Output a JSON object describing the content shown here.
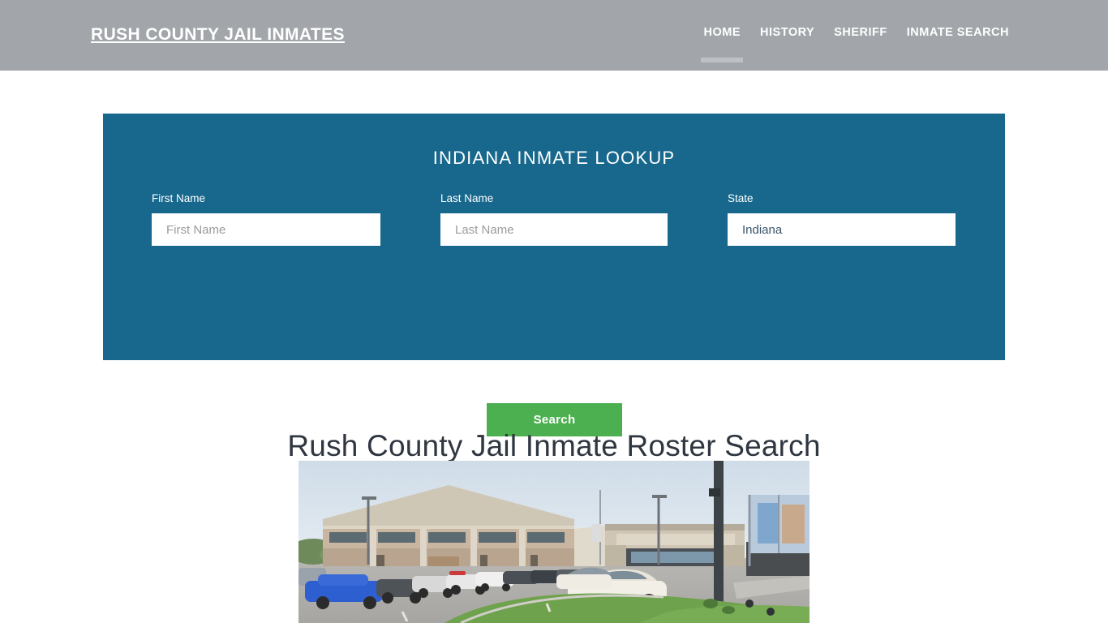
{
  "header": {
    "brand": "Rush County Jail Inmates",
    "nav": [
      {
        "label": "Home",
        "active": true
      },
      {
        "label": "History",
        "active": false
      },
      {
        "label": "Sheriff",
        "active": false
      },
      {
        "label": "Inmate Search",
        "active": false
      }
    ]
  },
  "lookup": {
    "title": "Indiana Inmate Lookup",
    "accent_color": "#17688c",
    "button_color": "#4cb050",
    "fields": {
      "first_name": {
        "label": "First Name",
        "placeholder": "First Name",
        "value": ""
      },
      "last_name": {
        "label": "Last Name",
        "placeholder": "Last Name",
        "value": ""
      },
      "state": {
        "label": "State",
        "value": "Indiana",
        "options": [
          "Indiana"
        ]
      }
    },
    "search_button": "Search"
  },
  "main": {
    "heading": "Rush County Jail Inmate Roster Search",
    "photo_alt": "rush-county-jail-building-photo"
  }
}
